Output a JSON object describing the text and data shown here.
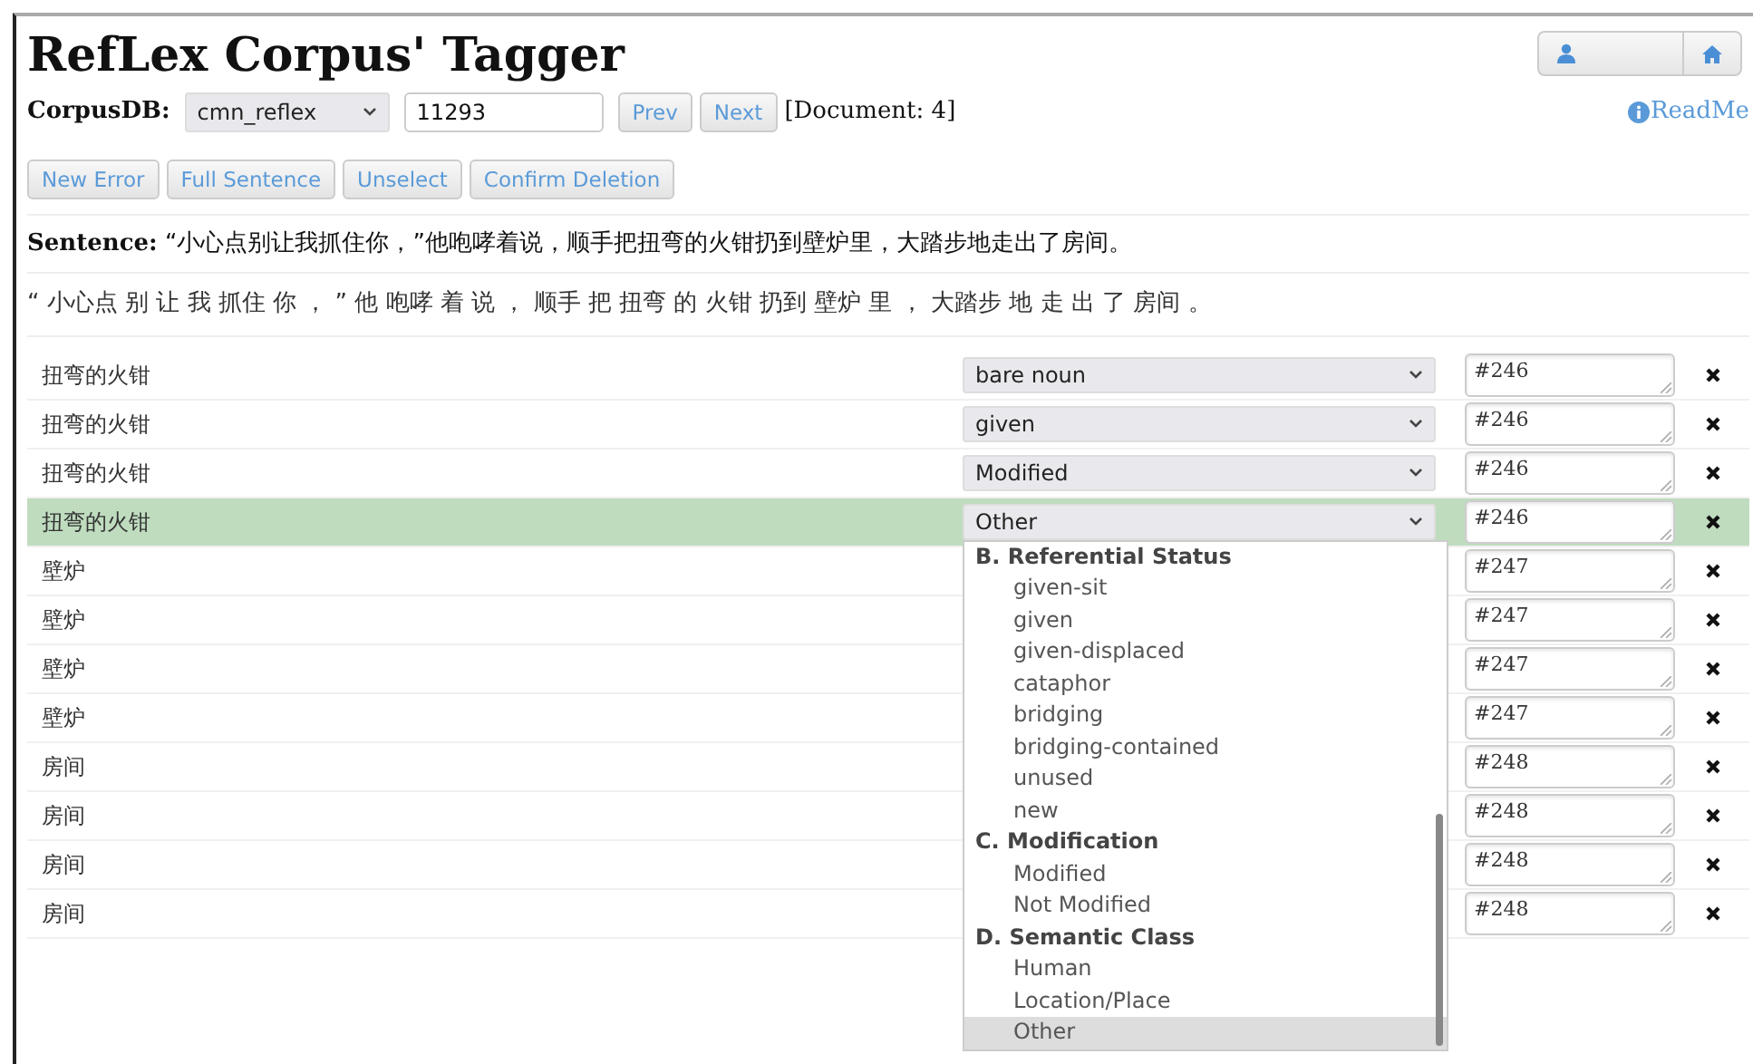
{
  "title": "RefLex Corpus' Tagger",
  "top_buttons": [
    {
      "kind": "user"
    },
    {
      "kind": "home"
    }
  ],
  "corpus": {
    "label": "CorpusDB:",
    "database": "cmn_reflex",
    "sentence_id": "11293",
    "prev": "Prev",
    "next": "Next",
    "document": "[Document: 4]",
    "readme": "ReadMe"
  },
  "actions": [
    "New Error",
    "Full Sentence",
    "Unselect",
    "Confirm Deletion"
  ],
  "sentence": {
    "label": "Sentence:",
    "text": "“小心点别让我抓住你，”他咆哮着说，顺手把扭弯的火钳扔到壁炉里，大踏步地走出了房间。"
  },
  "tokens": "“ 小心点 别 让 我 抓住 你 ， ” 他 咆哮 着 说 ， 顺手 把 扭弯 的 火钳 扔到 壁炉 里 ， 大踏步 地 走 出 了 房间 。",
  "rows": [
    {
      "word": "扭弯的火钳",
      "tag": "bare noun",
      "ref": "#246",
      "selected": false
    },
    {
      "word": "扭弯的火钳",
      "tag": "given",
      "ref": "#246",
      "selected": false
    },
    {
      "word": "扭弯的火钳",
      "tag": "Modified",
      "ref": "#246",
      "selected": false
    },
    {
      "word": "扭弯的火钳",
      "tag": "Other",
      "ref": "#246",
      "selected": true
    },
    {
      "word": "壁炉",
      "ref": "#247",
      "selected": false
    },
    {
      "word": "壁炉",
      "ref": "#247",
      "selected": false
    },
    {
      "word": "壁炉",
      "ref": "#247",
      "selected": false
    },
    {
      "word": "壁炉",
      "ref": "#247",
      "selected": false
    },
    {
      "word": "房间",
      "ref": "#248",
      "selected": false
    },
    {
      "word": "房间",
      "ref": "#248",
      "selected": false
    },
    {
      "word": "房间",
      "ref": "#248",
      "selected": false
    },
    {
      "word": "房间",
      "ref": "#248",
      "selected": false
    }
  ],
  "dropdown": {
    "items": [
      {
        "kind": "group",
        "label": "B. Referential Status"
      },
      {
        "kind": "option",
        "label": "given-sit",
        "selected": false
      },
      {
        "kind": "option",
        "label": "given",
        "selected": false
      },
      {
        "kind": "option",
        "label": "given-displaced",
        "selected": false
      },
      {
        "kind": "option",
        "label": "cataphor",
        "selected": false
      },
      {
        "kind": "option",
        "label": "bridging",
        "selected": false
      },
      {
        "kind": "option",
        "label": "bridging-contained",
        "selected": false
      },
      {
        "kind": "option",
        "label": "unused",
        "selected": false
      },
      {
        "kind": "option",
        "label": "new",
        "selected": false
      },
      {
        "kind": "group",
        "label": "C. Modification"
      },
      {
        "kind": "option",
        "label": "Modified",
        "selected": false
      },
      {
        "kind": "option",
        "label": "Not Modified",
        "selected": false
      },
      {
        "kind": "group",
        "label": "D. Semantic Class"
      },
      {
        "kind": "option",
        "label": "Human",
        "selected": false
      },
      {
        "kind": "option",
        "label": "Location/Place",
        "selected": false
      },
      {
        "kind": "option",
        "label": "Other",
        "selected": true
      }
    ]
  }
}
